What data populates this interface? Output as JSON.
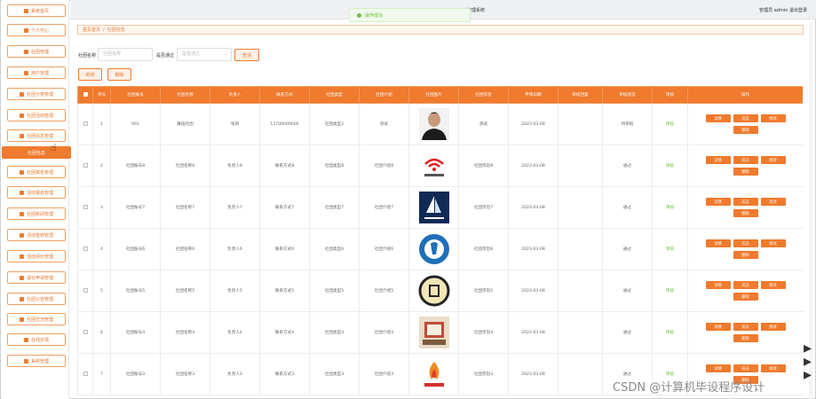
{
  "topbar": {
    "system_title": "管理系统",
    "user_info": "管理员 admin  退出登录",
    "toast": "操作成功"
  },
  "sidebar": {
    "items": [
      {
        "label": "系统首页",
        "icon": "home-icon"
      },
      {
        "label": "个人中心",
        "icon": "user-icon"
      },
      {
        "label": "社团管理",
        "icon": "user-icon"
      },
      {
        "label": "用户管理",
        "icon": "user-icon"
      },
      {
        "label": "社团分类管理",
        "icon": "grid-icon"
      },
      {
        "label": "社团活动管理",
        "icon": "chart-icon"
      },
      {
        "label": "社团信息管理",
        "icon": "grid-icon"
      },
      {
        "label": "社团信息",
        "icon": "",
        "active": true
      },
      {
        "label": "社团报名管理",
        "icon": "grid-icon"
      },
      {
        "label": "活动报名管理",
        "icon": "grid-icon"
      },
      {
        "label": "社团新闻管理",
        "icon": "grid-icon"
      },
      {
        "label": "活动签到管理",
        "icon": "grid-icon"
      },
      {
        "label": "活动评价管理",
        "icon": "grid-icon"
      },
      {
        "label": "退社申请管理",
        "icon": "grid-icon"
      },
      {
        "label": "社团公告管理",
        "icon": "grid-icon"
      },
      {
        "label": "社团交流管理",
        "icon": "grid-icon"
      },
      {
        "label": "在线反馈",
        "icon": "bell-icon"
      },
      {
        "label": "系统管理",
        "icon": "gear-icon"
      }
    ]
  },
  "breadcrumb": {
    "home": "首页首页",
    "separator": "/",
    "current": "社团信息"
  },
  "search": {
    "name_label": "社团名称",
    "name_placeholder": "社团名称",
    "review_label": "是否通过",
    "review_placeholder": "是否通过",
    "search_button": "查询",
    "add_button": "新增",
    "delete_button": "删除"
  },
  "table": {
    "columns": [
      "",
      "序号",
      "社团账号",
      "社团名称",
      "负责人",
      "联系方式",
      "社团类型",
      "社团介绍",
      "社团图片",
      "社团宗旨",
      "申请日期",
      "审核回复",
      "审核状态",
      "审核",
      "操作"
    ],
    "op_labels": {
      "detail": "详情",
      "member": "成员",
      "edit": "修改",
      "delete": "删除"
    },
    "rows": [
      {
        "index": "1",
        "account": "001",
        "name": "舞蹈社团",
        "leader": "张四",
        "contact": "13700000000",
        "type": "社团类型2",
        "intro": "测试",
        "purpose": "测试",
        "date": "2023-03-08",
        "reply": "",
        "review_status": "待审核",
        "audit": "审核",
        "logo": "portrait"
      },
      {
        "index": "2",
        "account": "社团账号8",
        "name": "社团名称8",
        "leader": "负责人8",
        "contact": "联系方式8",
        "type": "社团类型8",
        "intro": "社团介绍8",
        "purpose": "社团宗旨8",
        "date": "2023-03-08",
        "reply": "",
        "review_status": "通过",
        "audit": "审核",
        "logo": "wifi-logo"
      },
      {
        "index": "3",
        "account": "社团账号7",
        "name": "社团名称7",
        "leader": "负责人7",
        "contact": "联系方式7",
        "type": "社团类型7",
        "intro": "社团介绍7",
        "purpose": "社团宗旨7",
        "date": "2023-03-08",
        "reply": "",
        "review_status": "通过",
        "audit": "审核",
        "logo": "sail-logo"
      },
      {
        "index": "4",
        "account": "社团账号6",
        "name": "社团名称6",
        "leader": "负责人6",
        "contact": "联系方式6",
        "type": "社团类型6",
        "intro": "社团介绍6",
        "purpose": "社团宗旨6",
        "date": "2023-03-08",
        "reply": "",
        "review_status": "通过",
        "audit": "审核",
        "logo": "blue-circle-logo"
      },
      {
        "index": "5",
        "account": "社团账号5",
        "name": "社团名称5",
        "leader": "负责人5",
        "contact": "联系方式5",
        "type": "社团类型5",
        "intro": "社团介绍5",
        "purpose": "社团宗旨5",
        "date": "2023-03-08",
        "reply": "",
        "review_status": "通过",
        "audit": "审核",
        "logo": "chess-logo"
      },
      {
        "index": "6",
        "account": "社团账号4",
        "name": "社团名称4",
        "leader": "负责人4",
        "contact": "联系方式4",
        "type": "社团类型4",
        "intro": "社团介绍4",
        "purpose": "社团宗旨4",
        "date": "2023-03-08",
        "reply": "",
        "review_status": "通过",
        "audit": "审核",
        "logo": "book-logo"
      },
      {
        "index": "7",
        "account": "社团账号3",
        "name": "社团名称3",
        "leader": "负责人3",
        "contact": "联系方式3",
        "type": "社团类型3",
        "intro": "社团介绍3",
        "purpose": "社团宗旨3",
        "date": "2023-03-08",
        "reply": "",
        "review_status": "通过",
        "audit": "审核",
        "logo": "flame-logo"
      }
    ]
  },
  "watermark": "CSDN @计算机毕设程序设计",
  "colors": {
    "accent": "#f07a2d",
    "success": "#67c23a"
  }
}
